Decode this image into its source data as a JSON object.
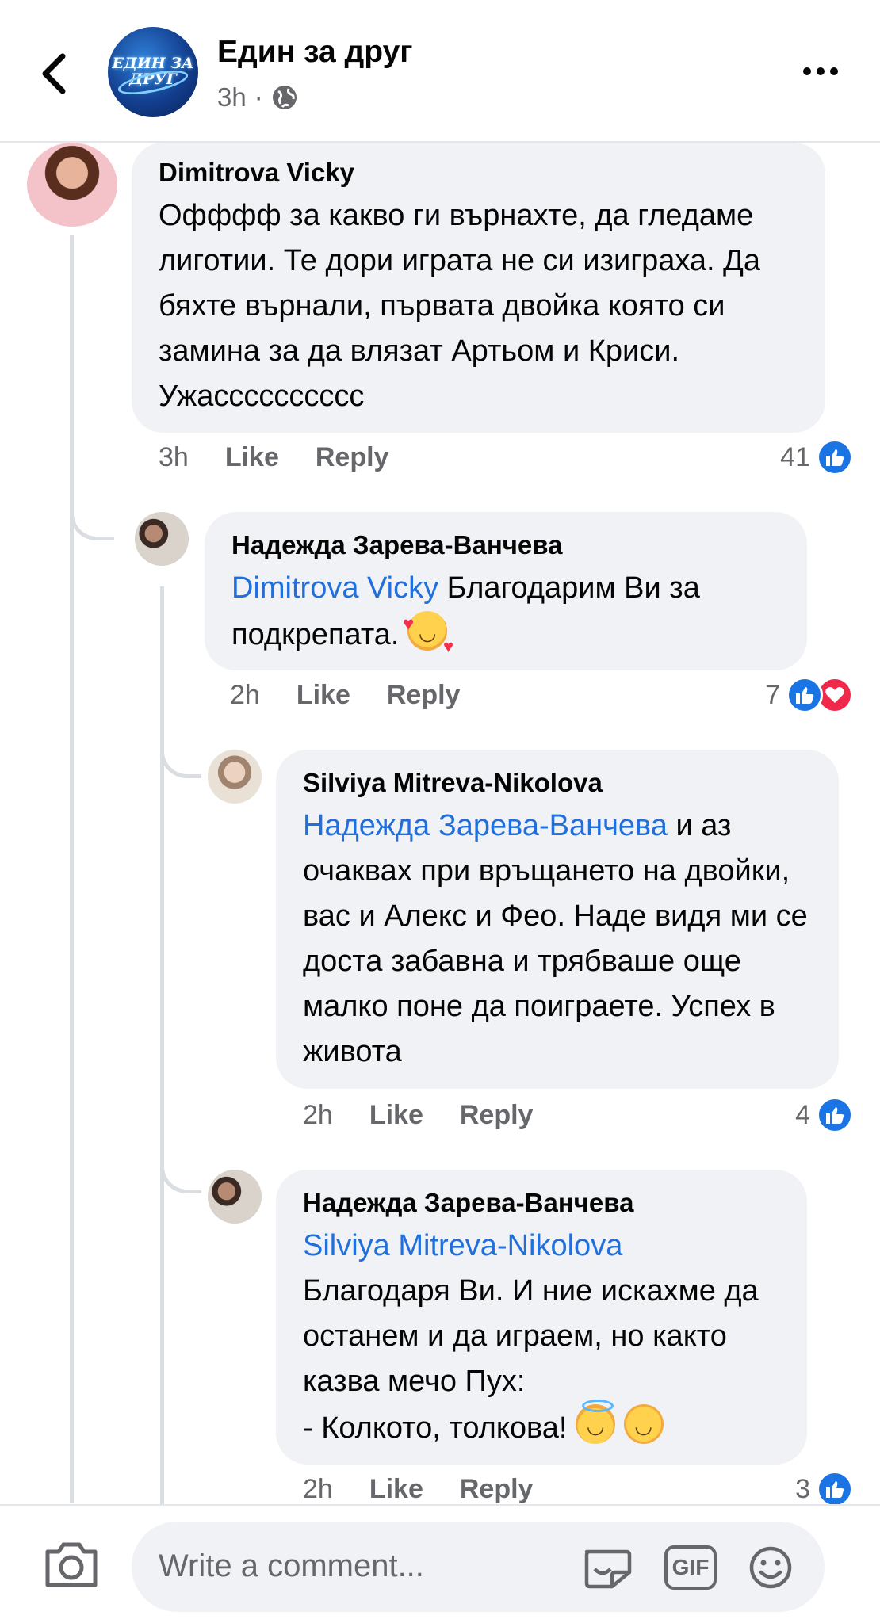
{
  "header": {
    "page_name": "Един за друг",
    "logo_text_line1": "ЕДИН ЗА",
    "logo_text_line2": "ДРУГ",
    "time": "3h",
    "separator": "·"
  },
  "comments": [
    {
      "author": "Dimitrova Vicky",
      "text": "Офффф за какво ги върнахте, да гледаме лиготии.  Те дори играта не си изиграха. Да бяхте върнали, първата двойка която си замина за да влязат Артьом и Криси. Ужасссссссссс",
      "time": "3h",
      "like_label": "Like",
      "reply_label": "Reply",
      "reaction_count": "41",
      "reactions": [
        "like"
      ]
    },
    {
      "author": "Надежда Зарева-Ванчева",
      "mention": "Dimitrova Vicky",
      "text": " Благодарим Ви за подкрепата. ",
      "emoji": "smiling-face-with-hearts",
      "time": "2h",
      "like_label": "Like",
      "reply_label": "Reply",
      "reaction_count": "7",
      "reactions": [
        "like",
        "love"
      ]
    },
    {
      "author": "Silviya Mitreva-Nikolova",
      "mention": "Надежда Зарева-Ванчева",
      "text": " и аз очаквах при връщането на двойки, вас и Алекс и Фео. Наде видя ми се доста забавна и трябваше още малко поне да поиграете. Успех в живота",
      "time": "2h",
      "like_label": "Like",
      "reply_label": "Reply",
      "reaction_count": "4",
      "reactions": [
        "like"
      ]
    },
    {
      "author": "Надежда Зарева-Ванчева",
      "mention": "Silviya Mitreva-Nikolova",
      "text_line1": "Благодаря Ви. И ние искахме да останем и да играем, но както казва мечо Пух:",
      "text_line2": "- Колкото, толкова!  ",
      "emojis": [
        "smiling-face-with-halo",
        "smiling-face-with-smiling-eyes"
      ],
      "time": "2h",
      "like_label": "Like",
      "reply_label": "Reply",
      "reaction_count": "3",
      "reactions": [
        "like"
      ]
    }
  ],
  "composer": {
    "placeholder": "Write a comment...",
    "gif_label": "GIF",
    "icons": [
      "camera-icon",
      "sticker-icon",
      "gif-icon",
      "emoji-icon"
    ]
  },
  "colors": {
    "accent": "#1b74e4",
    "mention": "#216fdb",
    "bubble": "#f0f2f5",
    "secondary_text": "#65676b",
    "love": "#f02849"
  }
}
